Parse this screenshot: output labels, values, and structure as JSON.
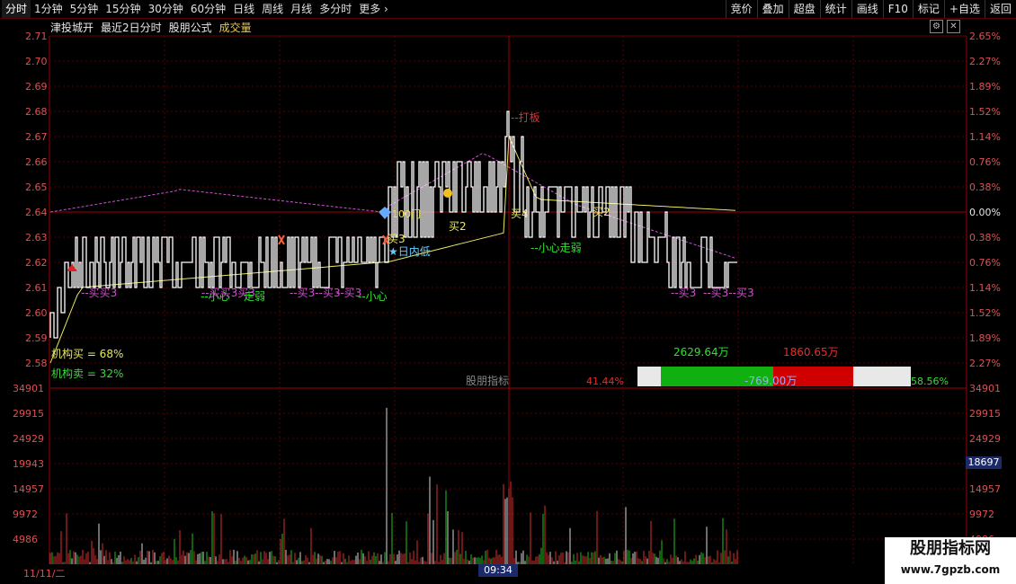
{
  "toolbar": {
    "tabs": [
      "分时",
      "1分钟",
      "5分钟",
      "15分钟",
      "30分钟",
      "60分钟",
      "日线",
      "周线",
      "月线",
      "多分时",
      "更多"
    ],
    "right_buttons": [
      "竞价",
      "叠加",
      "超盘",
      "统计",
      "画线",
      "F10",
      "标记",
      "+自选",
      "返回"
    ]
  },
  "title": {
    "stock_name": "津投城开",
    "subtitle": "最近2日分时",
    "formula": "股朋公式",
    "volume_label": "成交量"
  },
  "price_axis": {
    "left": [
      "2.71",
      "2.70",
      "2.69",
      "2.68",
      "2.67",
      "2.66",
      "2.65",
      "2.64",
      "2.63",
      "2.62",
      "2.61",
      "2.60",
      "2.59",
      "2.58"
    ],
    "right": [
      "2.65%",
      "2.27%",
      "1.89%",
      "1.52%",
      "1.14%",
      "0.76%",
      "0.38%",
      "0.00%",
      "0.38%",
      "0.76%",
      "1.14%",
      "1.52%",
      "1.89%",
      "2.27%"
    ]
  },
  "volume_axis": {
    "left": [
      "34901",
      "29915",
      "24929",
      "19943",
      "14957",
      "9972",
      "4986"
    ],
    "right": [
      "34901",
      "29915",
      "24929",
      "19943",
      "14957",
      "9972",
      "4986"
    ],
    "current_badge": "18697"
  },
  "annotations": {
    "dazhang": "--打板",
    "mai2": "买2",
    "mai4": "买4",
    "mai2b": "买2",
    "rineidi": "★日内低",
    "mai3a": "买3",
    "xiaoxin_zoudi": "--小心走弱",
    "xiaoxin1": "--小心",
    "zoudi1": "走弱",
    "xiaoxin2": "--小心",
    "mai3_list_left": "--买买3",
    "mai3_list_mid": "--买买3买3",
    "mai3_list_mid2": "--买3--买3",
    "mai3_list_mid3": "--买3",
    "mai3_right1": "--买3",
    "mai3_right2": "--买3--买3",
    "heat": "100门"
  },
  "institution": {
    "buy_label": "机构买 = 68%",
    "sell_label": "机构卖 = 32%"
  },
  "indicator": {
    "name": "股朋指标",
    "left_pct": "41.44%",
    "right_pct": "58.56%",
    "green_amount": "2629.64万",
    "red_amount": "1860.65万",
    "diff_amount": "-769.00万"
  },
  "dates": {
    "left_date": "11/11/二",
    "time": "09:34"
  },
  "watermark": {
    "title": "股朋指标网",
    "url": "www.7gpzb.com"
  },
  "colors": {
    "price_line": "#ffffff",
    "avg_line": "#e8e860",
    "ma_line": "#d050d0",
    "grid": "#6a0000",
    "axis_text": "#e05050",
    "green": "#10c010",
    "red": "#d00000"
  }
}
